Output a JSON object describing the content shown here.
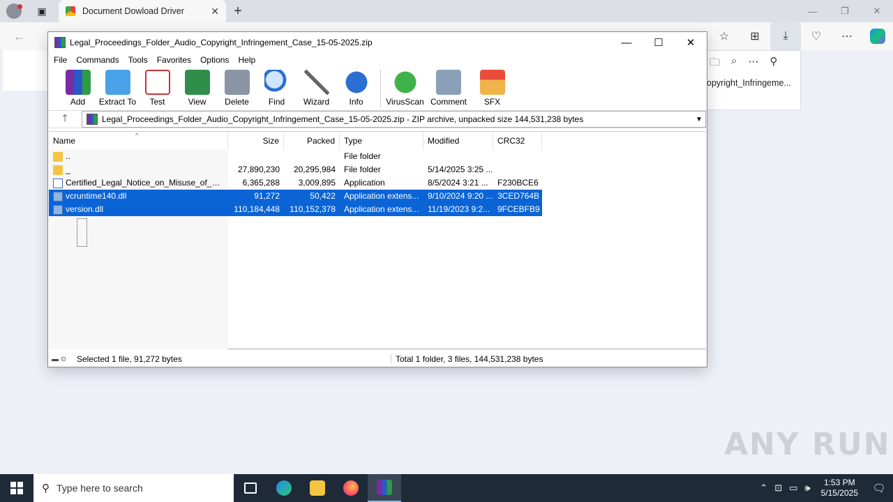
{
  "browser": {
    "tab_title": "Document Dowload Driver",
    "tab_close": "✕",
    "new_tab": "+",
    "window_controls": {
      "minimize": "—",
      "restore": "❐",
      "close": "✕"
    },
    "back": "←",
    "toolbar_icons": [
      "☆",
      "⊞",
      "⤓",
      "♡",
      "⋯"
    ],
    "download_flyout_text": "opyright_Infringeme..."
  },
  "rar": {
    "title": "Legal_Proceedings_Folder_Audio_Copyright_Infringement_Case_15-05-2025.zip",
    "window_controls": {
      "minimize": "—",
      "maximize": "☐",
      "close": "✕"
    },
    "menu": [
      "File",
      "Commands",
      "Tools",
      "Favorites",
      "Options",
      "Help"
    ],
    "toolbar": [
      "Add",
      "Extract To",
      "Test",
      "View",
      "Delete",
      "Find",
      "Wizard",
      "Info",
      "VirusScan",
      "Comment",
      "SFX"
    ],
    "path": "Legal_Proceedings_Folder_Audio_Copyright_Infringement_Case_15-05-2025.zip - ZIP archive, unpacked size 144,531,238 bytes",
    "columns": [
      "Name",
      "Size",
      "Packed",
      "Type",
      "Modified",
      "CRC32"
    ],
    "rows": [
      {
        "name": "..",
        "size": "",
        "packed": "",
        "type": "File folder",
        "modified": "",
        "crc": "",
        "icon": "folder",
        "selected": false
      },
      {
        "name": "_",
        "size": "27,890,230",
        "packed": "20,295,984",
        "type": "File folder",
        "modified": "5/14/2025 3:25 ...",
        "crc": "",
        "icon": "folder",
        "selected": false
      },
      {
        "name": "Certified_Legal_Notice_on_Misuse_of_Prot...",
        "size": "6,365,288",
        "packed": "3,009,895",
        "type": "Application",
        "modified": "8/5/2024 3:21 ...",
        "crc": "F230BCE6",
        "icon": "app",
        "selected": false
      },
      {
        "name": "vcruntime140.dll",
        "size": "91,272",
        "packed": "50,422",
        "type": "Application extens...",
        "modified": "9/10/2024 9:20 ...",
        "crc": "3CED764B",
        "icon": "dll",
        "selected": true
      },
      {
        "name": "version.dll",
        "size": "110,184,448",
        "packed": "110,152,378",
        "type": "Application extens...",
        "modified": "11/19/2023 9:2...",
        "crc": "9FCEBFB9",
        "icon": "dll",
        "selected": true
      }
    ],
    "status_left": "Selected 1 file, 91,272 bytes",
    "status_right": "Total 1 folder, 3 files, 144,531,238 bytes"
  },
  "watermark": "ANY RUN",
  "taskbar": {
    "search_placeholder": "Type here to search",
    "time": "1:53 PM",
    "date": "5/15/2025"
  }
}
